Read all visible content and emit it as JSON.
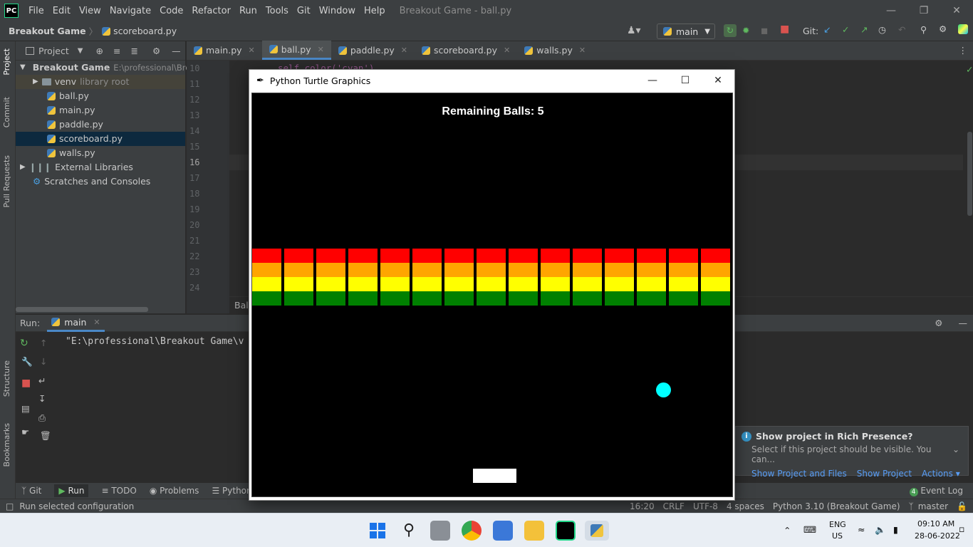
{
  "titlebar": {
    "logo": "PC",
    "menu": [
      "File",
      "Edit",
      "View",
      "Navigate",
      "Code",
      "Refactor",
      "Run",
      "Tools",
      "Git",
      "Window",
      "Help"
    ],
    "title": "Breakout Game - ball.py"
  },
  "navbar": {
    "project": "Breakout Game",
    "file": "scoreboard.py",
    "run_config": "main",
    "git_label": "Git:"
  },
  "left_tools": [
    "Project",
    "Commit",
    "Pull Requests",
    "Structure",
    "Bookmarks"
  ],
  "project_panel": {
    "title": "Project",
    "root": "Breakout Game",
    "root_path": "E:\\professional\\Brea",
    "venv": "venv",
    "venv_note": "library root",
    "files": [
      "ball.py",
      "main.py",
      "paddle.py",
      "scoreboard.py",
      "walls.py"
    ],
    "selected": "scoreboard.py",
    "external": "External Libraries",
    "scratches": "Scratches and Consoles"
  },
  "editor": {
    "tabs": [
      "main.py",
      "ball.py",
      "paddle.py",
      "scoreboard.py",
      "walls.py"
    ],
    "active_tab": "ball.py",
    "line_numbers": [
      "10",
      "11",
      "12",
      "13",
      "14",
      "15",
      "16",
      "17",
      "18",
      "19",
      "20",
      "21",
      "22",
      "23",
      "24"
    ],
    "partial_code": "self.color('cyan')",
    "breadcrumb_stub": "Ball"
  },
  "run_panel": {
    "label": "Run:",
    "config": "main",
    "console_text": "\"E:\\professional\\Breakout Game\\v"
  },
  "bottom_tabs": [
    "Git",
    "Run",
    "TODO",
    "Problems",
    "Python"
  ],
  "event_log": {
    "count": "4",
    "label": "Event Log"
  },
  "notification": {
    "title": "Show project in Rich Presence?",
    "body": "Select if this project should be visible. You can...",
    "links": [
      "Show Project and Files",
      "Show Project",
      "Actions"
    ]
  },
  "statusbar": {
    "message": "Run selected configuration",
    "position": "16:20",
    "line_sep": "CRLF",
    "encoding": "UTF-8",
    "indent": "4 spaces",
    "interpreter": "Python 3.10 (Breakout Game)",
    "branch": "master"
  },
  "turtle_window": {
    "title": "Python Turtle Graphics",
    "score_text": "Remaining Balls: 5",
    "brick_columns": 15,
    "brick_rows": [
      "#ff0000",
      "#ffa500",
      "#ffff00",
      "#008000"
    ],
    "ball_color": "#00ffff",
    "paddle_color": "#ffffff"
  },
  "taskbar": {
    "lang1": "ENG",
    "lang2": "US",
    "time": "09:10 AM",
    "date": "28-06-2022"
  }
}
